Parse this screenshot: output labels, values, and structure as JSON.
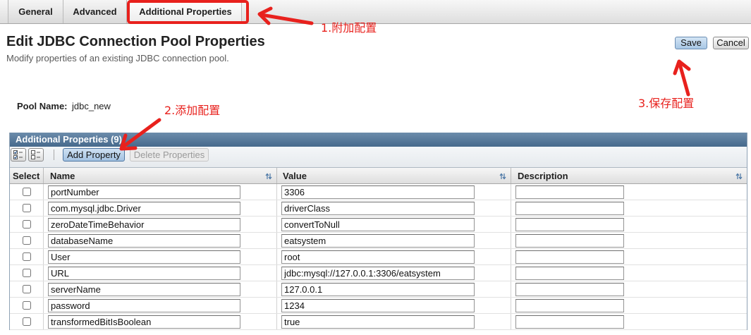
{
  "tabs": [
    {
      "label": "General",
      "selected": false
    },
    {
      "label": "Advanced",
      "selected": false
    },
    {
      "label": "Additional Properties",
      "selected": true
    }
  ],
  "page": {
    "title": "Edit JDBC Connection Pool Properties",
    "subtitle": "Modify properties of an existing JDBC connection pool."
  },
  "actions": {
    "save_label": "Save",
    "cancel_label": "Cancel"
  },
  "pool": {
    "name_label": "Pool Name:",
    "name_value": "jdbc_new"
  },
  "properties_table": {
    "title": "Additional Properties (9)",
    "toolbar": {
      "add_label": "Add Property",
      "delete_label": "Delete Properties",
      "delete_enabled": false
    },
    "columns": {
      "select": "Select",
      "name": "Name",
      "value": "Value",
      "description": "Description"
    },
    "rows": [
      {
        "selected": false,
        "name": "portNumber",
        "value": "3306",
        "description": ""
      },
      {
        "selected": false,
        "name": "com.mysql.jdbc.Driver",
        "value": "driverClass",
        "description": ""
      },
      {
        "selected": false,
        "name": "zeroDateTimeBehavior",
        "value": "convertToNull",
        "description": ""
      },
      {
        "selected": false,
        "name": "databaseName",
        "value": "eatsystem",
        "description": ""
      },
      {
        "selected": false,
        "name": "User",
        "value": "root",
        "description": ""
      },
      {
        "selected": false,
        "name": "URL",
        "value": "jdbc:mysql://127.0.0.1:3306/eatsystem",
        "description": ""
      },
      {
        "selected": false,
        "name": "serverName",
        "value": "127.0.0.1",
        "description": ""
      },
      {
        "selected": false,
        "name": "password",
        "value": "1234",
        "description": ""
      },
      {
        "selected": false,
        "name": "transformedBitIsBoolean",
        "value": "true",
        "description": ""
      }
    ]
  },
  "annotations": {
    "step1": "1.附加配置",
    "step2": "2.添加配置",
    "step3": "3.保存配置"
  },
  "icons": {
    "select_all": "select-all-icon",
    "deselect_all": "deselect-all-icon",
    "sort": "sort-icon"
  },
  "colors": {
    "annotation": "#e8211d",
    "table_title_bar": "#4f7193",
    "primary_button": "#b7d1ea",
    "disabled_text": "#9a9a9a"
  }
}
